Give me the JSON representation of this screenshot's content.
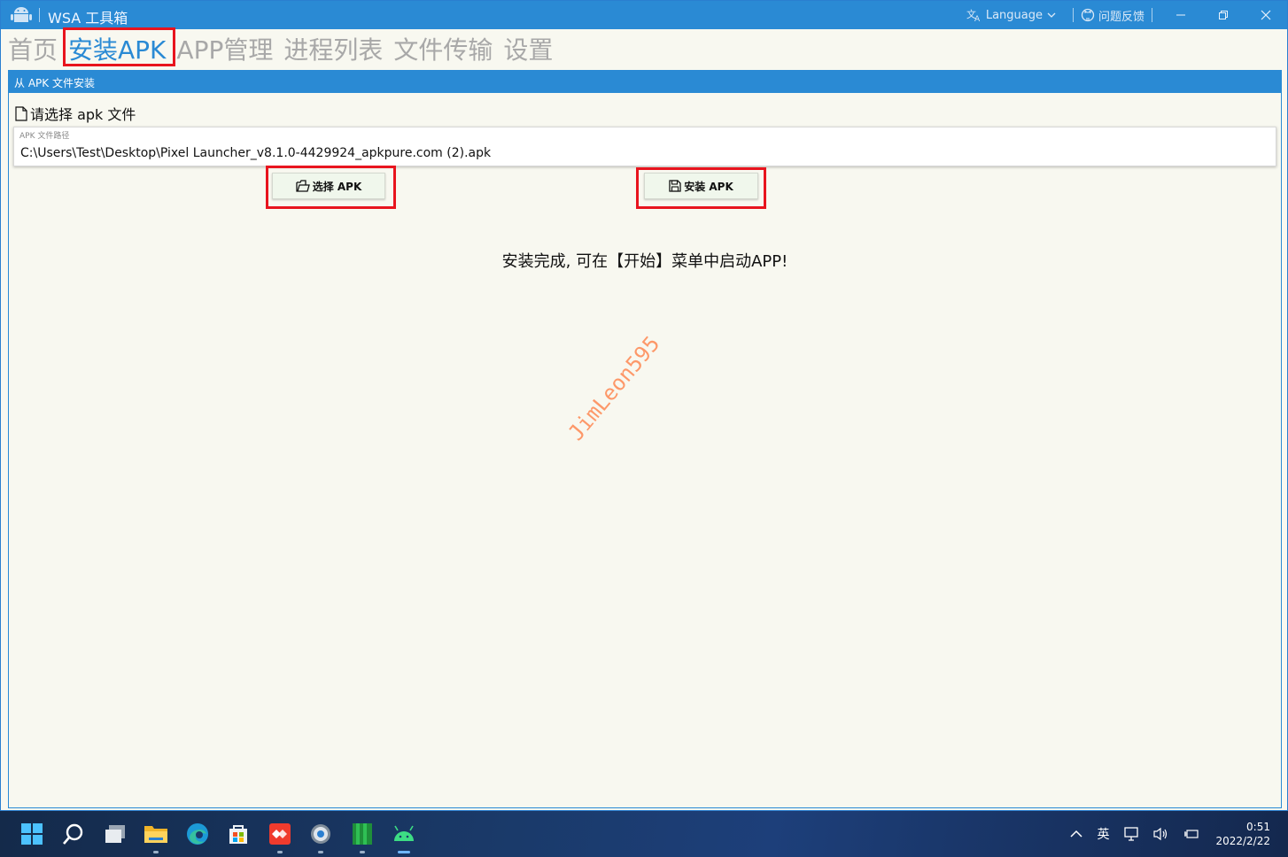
{
  "window": {
    "title": "WSA 工具箱",
    "language_label": "Language",
    "feedback_label": "问题反馈"
  },
  "nav": {
    "tabs": [
      {
        "label": "首页",
        "active": false
      },
      {
        "label": "安装APK",
        "active": true
      },
      {
        "label": "APP管理",
        "active": false
      },
      {
        "label": "进程列表",
        "active": false
      },
      {
        "label": "文件传输",
        "active": false
      },
      {
        "label": "设置",
        "active": false
      }
    ]
  },
  "panel": {
    "header": "从 APK 文件安装",
    "select_prompt": "请选择 apk 文件",
    "path_label": "APK 文件路径",
    "path_value": "C:\\Users\\Test\\Desktop\\Pixel Launcher_v8.1.0-4429924_apkpure.com (2).apk",
    "select_button": "选择 APK",
    "install_button": "安装 APK",
    "status_message": "安装完成, 可在【开始】菜单中启动APP!"
  },
  "watermark": "JimLeon595",
  "taskbar": {
    "ime": "英",
    "time": "0:51",
    "date": "2022/2/22"
  },
  "colors": {
    "accent": "#2a8ad4",
    "highlight": "#e8141e",
    "inactive_tab": "#a8a8a8"
  }
}
